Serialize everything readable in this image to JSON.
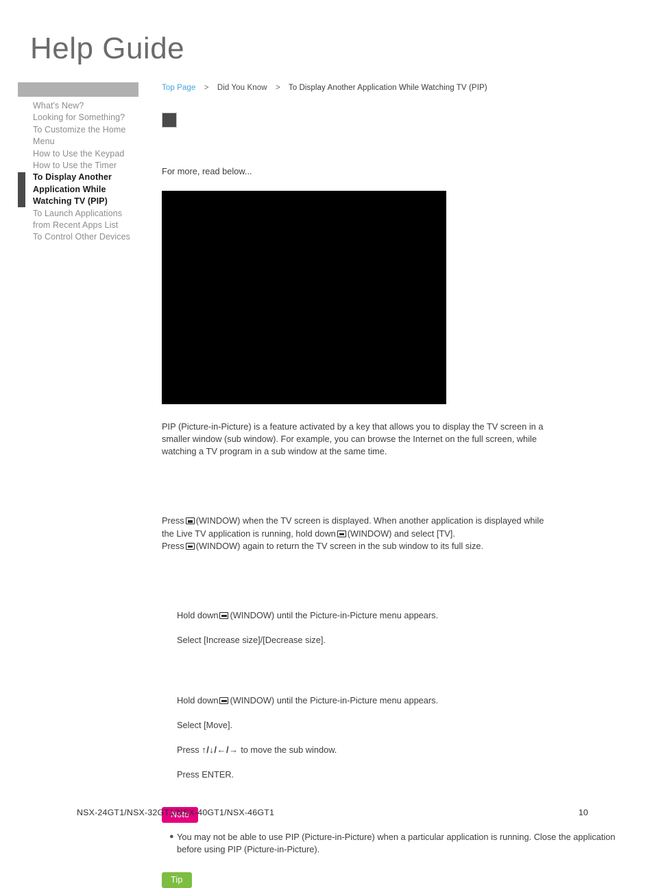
{
  "masthead": {
    "title": "Help Guide"
  },
  "sidebar": {
    "items": [
      {
        "label": "What's New?",
        "active": false
      },
      {
        "label": "Looking for Something?",
        "active": false
      },
      {
        "label": "To Customize the Home Menu",
        "active": false
      },
      {
        "label": "How to Use the Keypad",
        "active": false
      },
      {
        "label": "How to Use the Timer",
        "active": false
      },
      {
        "label": "To Display Another Application While Watching TV (PIP)",
        "active": true
      },
      {
        "label": "To Launch Applications from Recent Apps List",
        "active": false
      },
      {
        "label": "To Control Other Devices",
        "active": false
      }
    ]
  },
  "breadcrumb": {
    "top": "Top Page",
    "separator": ">",
    "parent": "Did You Know",
    "current": "To Display Another Application While Watching TV (PIP)"
  },
  "main": {
    "lead": "For more, read below...",
    "intro_paragraph": "PIP (Picture-in-Picture) is a feature activated by a key that allows you to display the TV screen in a smaller window (sub window). For example, you can browse the Internet on the full screen, while watching a TV program in a sub window at the same time.",
    "press_line_1_a": "Press",
    "press_line_1_b": "(WINDOW) when the TV screen is displayed. When another application is displayed while the Live TV application is running, hold down",
    "press_line_1_c": "(WINDOW) and select [TV].",
    "press_line_2_a": "Press",
    "press_line_2_b": "(WINDOW) again to return the TV screen in the sub window to its full size.",
    "resize_steps": [
      {
        "pre": "Hold down",
        "post": "(WINDOW) until the Picture-in-Picture menu appears.",
        "icon": "window-key-icon"
      },
      {
        "pre": "Select [Increase size]/[Decrease size].",
        "post": "",
        "icon": ""
      }
    ],
    "move_steps": [
      {
        "pre": "Hold down",
        "post": "(WINDOW) until the Picture-in-Picture menu appears.",
        "icon": "window-key-icon"
      },
      {
        "pre": "Select [Move].",
        "post": "",
        "icon": ""
      },
      {
        "pre": "Press",
        "post": "to move the sub window.",
        "icon": "arrow-keys-icon",
        "arrows": "↑/↓/←/→"
      },
      {
        "pre": "Press ENTER.",
        "post": "",
        "icon": ""
      }
    ],
    "note": {
      "badge": "Note",
      "items": [
        "You may not be able to use PIP (Picture-in-Picture) when a particular application is running. Close the application before using PIP (Picture-in-Picture)."
      ]
    },
    "tip": {
      "badge": "Tip"
    }
  },
  "footer": {
    "models": "NSX-24GT1/NSX-32GT1/NSX-40GT1/NSX-46GT1",
    "page_number": "10"
  },
  "colors": {
    "link": "#49a3dc",
    "note_badge": "#e4007f",
    "tip_badge": "#7dbd42",
    "sidebar_header_bar": "#b0b0b0",
    "active_marker": "#4a4a4a",
    "image_placeholder": "#4a4a4a",
    "hero_image": "#000000"
  }
}
